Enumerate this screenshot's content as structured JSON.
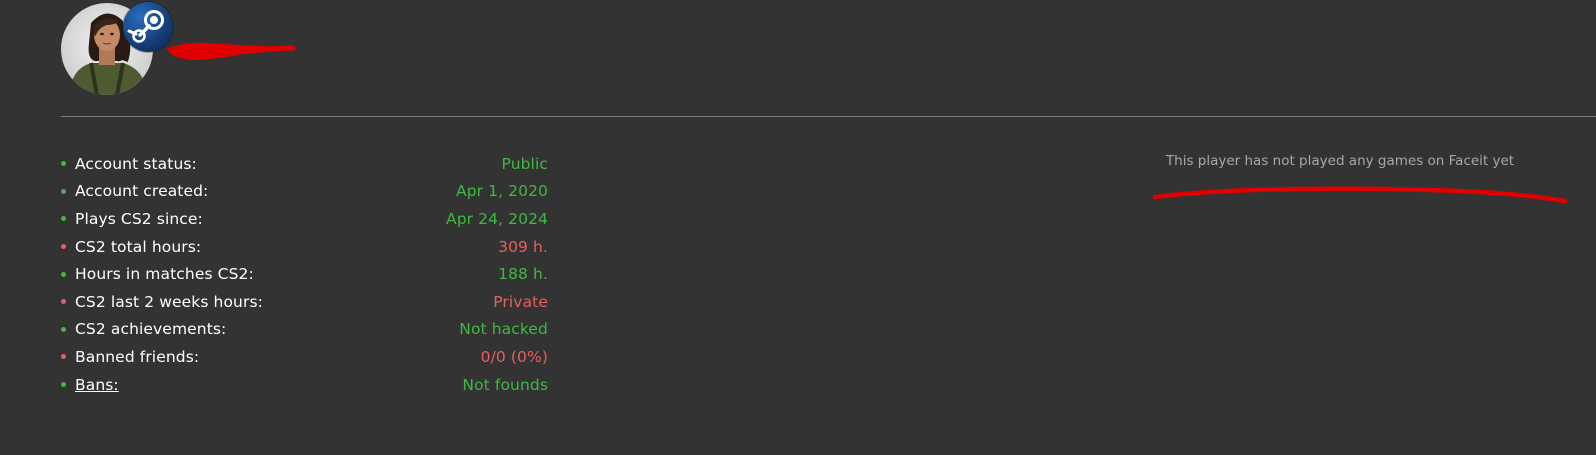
{
  "profile": {
    "avatar_icon": "player-avatar",
    "platform_icon": "steam-logo-icon",
    "name_redacted": true
  },
  "colors": {
    "background": "#333333",
    "good": "#3fb93f",
    "bad": "#e46060",
    "redaction": "#e00000"
  },
  "stats": [
    {
      "label": "Account status:",
      "value": "Public",
      "status": "good"
    },
    {
      "label": "Account created:",
      "value": "Apr 1, 2020",
      "status": "good"
    },
    {
      "label": "Plays CS2 since:",
      "value": "Apr 24, 2024",
      "status": "good"
    },
    {
      "label": "CS2 total hours:",
      "value": "309 h.",
      "status": "bad"
    },
    {
      "label": "Hours in matches CS2:",
      "value": "188 h.",
      "status": "good"
    },
    {
      "label": "CS2 last 2 weeks hours:",
      "value": "Private",
      "status": "bad"
    },
    {
      "label": "CS2 achievements:",
      "value": "Not hacked",
      "status": "good"
    },
    {
      "label": "Banned friends:",
      "value": "0/0 (0%)",
      "status": "bad"
    },
    {
      "label": "Bans:",
      "value": "Not founds",
      "status": "good",
      "link": true
    }
  ],
  "faceit": {
    "message": "This player has not played any games on Faceit yet"
  }
}
